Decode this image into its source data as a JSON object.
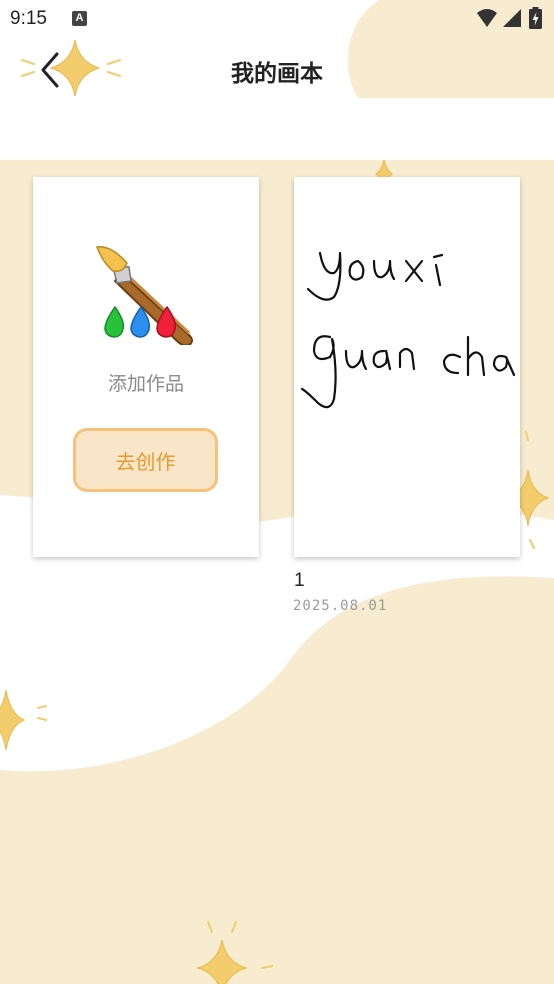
{
  "status_bar": {
    "time": "9:15",
    "notification_icon": "A",
    "icons": [
      "wifi-icon",
      "cell-signal-icon",
      "battery-charging-icon"
    ]
  },
  "header": {
    "title": "我的画本",
    "back_icon": "chevron-left-icon"
  },
  "colors": {
    "background_shape": "#f7ebd0",
    "sparkle": "#f3cd6b",
    "button_border": "#f6c27c",
    "button_fill": "#f9e6c8",
    "button_text": "#e49a2e"
  },
  "add_card": {
    "icon": "paintbrush-with-paint-drops-icon",
    "label": "添加作品",
    "button_label": "去创作"
  },
  "artworks": [
    {
      "handwriting": [
        "youxi",
        "guan cha"
      ],
      "name": "1",
      "date": "2025.08.01"
    }
  ]
}
